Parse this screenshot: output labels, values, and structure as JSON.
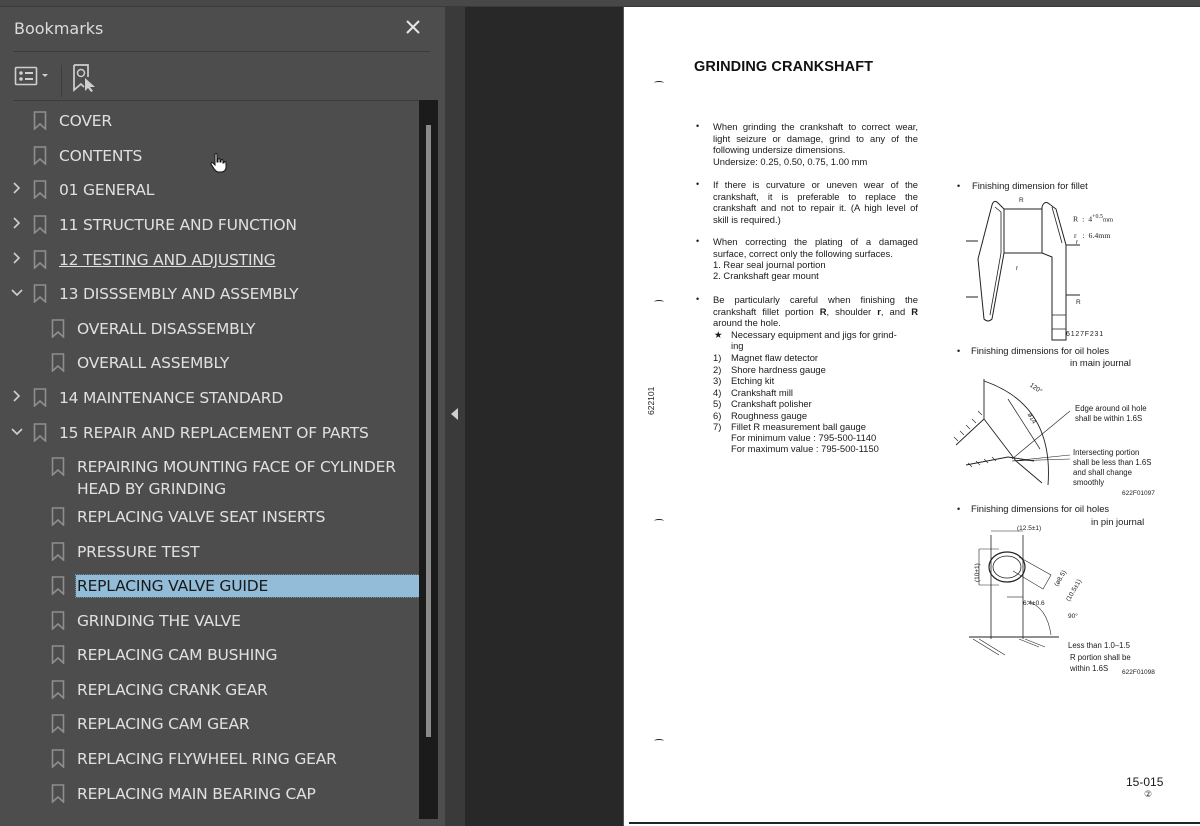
{
  "bookmarks_panel": {
    "title": "Bookmarks",
    "close_icon": "close-icon",
    "toolbar": {
      "options_icon": "list-options-icon",
      "find_icon": "find-bookmark-icon"
    },
    "items": [
      {
        "label": "COVER",
        "level": 0,
        "expander": "none"
      },
      {
        "label": "CONTENTS",
        "level": 0,
        "expander": "none"
      },
      {
        "label": "01 GENERAL",
        "level": 0,
        "expander": "collapsed"
      },
      {
        "label": "11 STRUCTURE AND FUNCTION",
        "level": 0,
        "expander": "collapsed"
      },
      {
        "label": "12 TESTING AND ADJUSTING",
        "level": 0,
        "expander": "collapsed",
        "hovered": true
      },
      {
        "label": "13 DISSSEMBLY AND ASSEMBLY",
        "level": 0,
        "expander": "expanded"
      },
      {
        "label": "OVERALL DISASSEMBLY",
        "level": 1,
        "expander": "none"
      },
      {
        "label": "OVERALL ASSEMBLY",
        "level": 1,
        "expander": "none"
      },
      {
        "label": "14 MAINTENANCE STANDARD",
        "level": 0,
        "expander": "collapsed"
      },
      {
        "label": "15 REPAIR AND REPLACEMENT OF PARTS",
        "level": 0,
        "expander": "expanded"
      },
      {
        "label": "REPAIRING MOUNTING FACE OF CYLINDER HEAD BY GRINDING",
        "level": 1,
        "expander": "none"
      },
      {
        "label": "REPLACING VALVE SEAT INSERTS",
        "level": 1,
        "expander": "none"
      },
      {
        "label": "PRESSURE TEST",
        "level": 1,
        "expander": "none"
      },
      {
        "label": "REPLACING VALVE GUIDE",
        "level": 1,
        "expander": "none",
        "selected": true
      },
      {
        "label": "GRINDING THE VALVE",
        "level": 1,
        "expander": "none"
      },
      {
        "label": "REPLACING CAM BUSHING",
        "level": 1,
        "expander": "none"
      },
      {
        "label": "REPLACING CRANK GEAR",
        "level": 1,
        "expander": "none"
      },
      {
        "label": "REPLACING CAM GEAR",
        "level": 1,
        "expander": "none"
      },
      {
        "label": "REPLACING FLYWHEEL RING GEAR",
        "level": 1,
        "expander": "none"
      },
      {
        "label": "REPLACING MAIN BEARING CAP",
        "level": 1,
        "expander": "none"
      }
    ]
  },
  "colors": {
    "panel_bg": "#4d4d4d",
    "viewer_bg": "#282828",
    "selection": "#93bcd8",
    "text": "#e0e0e0"
  },
  "document": {
    "title": "GRINDING CRANKSHAFT",
    "side_code": "622101",
    "paragraphs": [
      "When grinding the crankshaft to correct wear, light seizure or damage, grind to any of the following undersize dimensions.",
      "If there is curvature or uneven wear of the crankshaft, it is preferable to replace the crankshaft and not to repair it. (A high level of skill is required.)",
      "When correcting the plating of a damaged surface, correct only the following surfaces."
    ],
    "undersize_line": "Undersize: 0.25, 0.50, 0.75, 1.00 mm",
    "plating_list": [
      "1.  Rear seal journal portion",
      "2.  Crankshaft gear mount"
    ],
    "careful_para_a": "Be particularly careful when finishing the crankshaft fillet portion ",
    "careful_R": "R",
    "careful_para_b": ", shoulder ",
    "careful_r": "r",
    "careful_para_c": ", and ",
    "careful_R2": "R",
    "careful_para_d": " around the hole.",
    "equipment_star": "★",
    "equipment_heading_1": "Necessary equipment and jigs for grind-",
    "equipment_heading_2": "ing",
    "equipment": [
      {
        "num": "1)",
        "text": "Magnet flaw detector"
      },
      {
        "num": "2)",
        "text": "Shore hardness gauge"
      },
      {
        "num": "3)",
        "text": "Etching kit"
      },
      {
        "num": "4)",
        "text": "Crankshaft mill"
      },
      {
        "num": "5)",
        "text": "Crankshaft polisher"
      },
      {
        "num": "6)",
        "text": "Roughness gauge"
      },
      {
        "num": "7)",
        "text": "Fillet R measurement ball gauge"
      }
    ],
    "gauge_min": "For minimum value : 795-500-1140",
    "gauge_max": "For maximum value : 795-500-1150",
    "fig1": {
      "heading": "Finishing dimension for fillet",
      "R_label": "R",
      "R_value": "4",
      "R_tol_plus": "+0.5",
      "R_tol_minus": "0",
      "R_unit": "mm",
      "r_label": "r",
      "r_value": "6.4mm",
      "colon": ":",
      "code": "6127F231",
      "callout_R": "R",
      "callout_r": "r"
    },
    "fig2": {
      "heading_1": "Finishing dimensions for oil holes",
      "heading_2": "in main journal",
      "angle": "120°",
      "dia": "ø14",
      "note1_1": "Edge around oil hole",
      "note1_2": "shall be within 1.6S",
      "note2_1": "Intersecting portion",
      "note2_2": "shall be less than 1.6S",
      "note2_3": "and shall change",
      "note2_4": "smoothly",
      "code": "622F01097"
    },
    "fig3": {
      "heading_1": "Finishing dimensions for oil holes",
      "heading_2": "in pin journal",
      "dim_width": "(12.5±1)",
      "dim_height": "(10±1)",
      "dim_diag1": "(ø8.5)",
      "dim_diag2": "(10.5±1)",
      "dim_offset": "6.4±0.6",
      "angle": "90°",
      "note1": "Less than 1.0–1.5",
      "note2_1": "R portion shall be",
      "note2_2": "within 1.6S",
      "code": "622F01098"
    },
    "page_number": "15-015",
    "revision": "②"
  }
}
